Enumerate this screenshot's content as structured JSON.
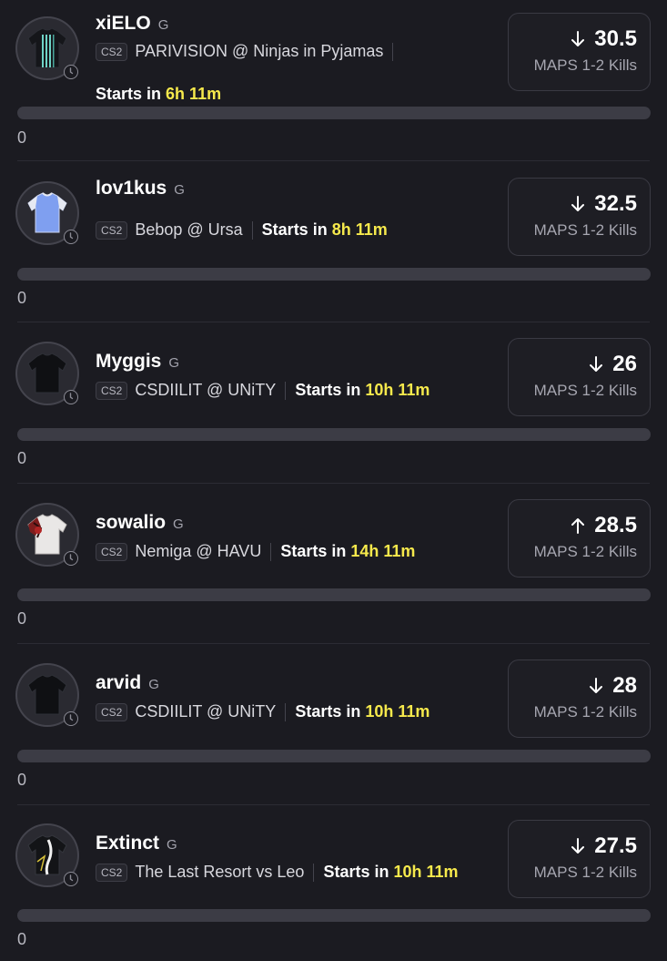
{
  "projections": [
    {
      "player": "xiELO",
      "position": "G",
      "league": "CS2",
      "matchup": "PARIVISION @ Ninjas in Pyjamas",
      "starts_label": "Starts in",
      "starts_time": "6h 11m",
      "direction": "down",
      "line": "30.5",
      "stat": "MAPS 1-2 Kills",
      "progress": 0,
      "count": "0",
      "jersey": "striped-dark"
    },
    {
      "player": "lov1kus",
      "position": "G",
      "league": "CS2",
      "matchup": "Bebop @ Ursa",
      "starts_label": "Starts in",
      "starts_time": "8h 11m",
      "direction": "down",
      "line": "32.5",
      "stat": "MAPS 1-2 Kills",
      "progress": 0,
      "count": "0",
      "jersey": "blue"
    },
    {
      "player": "Myggis",
      "position": "G",
      "league": "CS2",
      "matchup": "CSDIILIT @ UNiTY",
      "starts_label": "Starts in",
      "starts_time": "10h 11m",
      "direction": "down",
      "line": "26",
      "stat": "MAPS 1-2 Kills",
      "progress": 0,
      "count": "0",
      "jersey": "black"
    },
    {
      "player": "sowalio",
      "position": "G",
      "league": "CS2",
      "matchup": "Nemiga @ HAVU",
      "starts_label": "Starts in",
      "starts_time": "14h 11m",
      "direction": "up",
      "line": "28.5",
      "stat": "MAPS 1-2 Kills",
      "progress": 0,
      "count": "0",
      "jersey": "white-red"
    },
    {
      "player": "arvid",
      "position": "G",
      "league": "CS2",
      "matchup": "CSDIILIT @ UNiTY",
      "starts_label": "Starts in",
      "starts_time": "10h 11m",
      "direction": "down",
      "line": "28",
      "stat": "MAPS 1-2 Kills",
      "progress": 0,
      "count": "0",
      "jersey": "black"
    },
    {
      "player": "Extinct",
      "position": "G",
      "league": "CS2",
      "matchup": "The Last Resort vs Leo",
      "starts_label": "Starts in",
      "starts_time": "10h 11m",
      "direction": "down",
      "line": "27.5",
      "stat": "MAPS 1-2 Kills",
      "progress": 0,
      "count": "0",
      "jersey": "black-white"
    }
  ]
}
